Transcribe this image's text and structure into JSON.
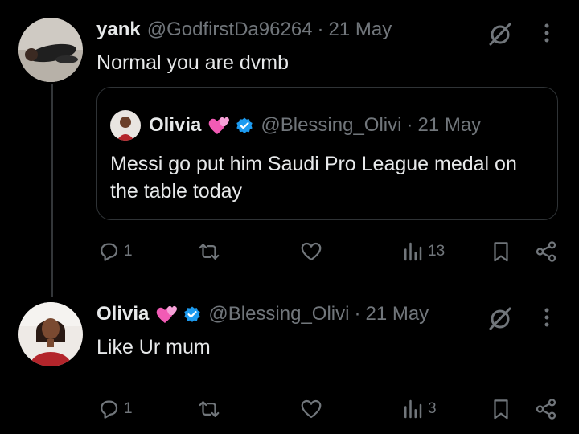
{
  "colors": {
    "background": "#000000",
    "text": "#e7e9ea",
    "secondary": "#71767b",
    "verified": "#1d9bf0",
    "border": "#2f3336"
  },
  "tweets": [
    {
      "name": "yank",
      "handle": "@GodfirstDa96264",
      "separator": "·",
      "date": "21 May",
      "text": "Normal you are dvmb",
      "quote": {
        "name": "Olivia",
        "emoji": "heart-ribbon-emoji",
        "verified": true,
        "handle": "@Blessing_Olivi",
        "separator": "·",
        "date": "21 May",
        "text": "Messi go put him Saudi Pro League medal on the table today"
      },
      "actions": {
        "replies": "1",
        "retweets": "",
        "likes": "",
        "views": "13"
      }
    },
    {
      "name": "Olivia",
      "emoji": "heart-ribbon-emoji",
      "verified": true,
      "handle": "@Blessing_Olivi",
      "separator": "·",
      "date": "21 May",
      "text": "Like Ur mum",
      "actions": {
        "replies": "1",
        "retweets": "",
        "likes": "",
        "views": "3"
      }
    }
  ]
}
